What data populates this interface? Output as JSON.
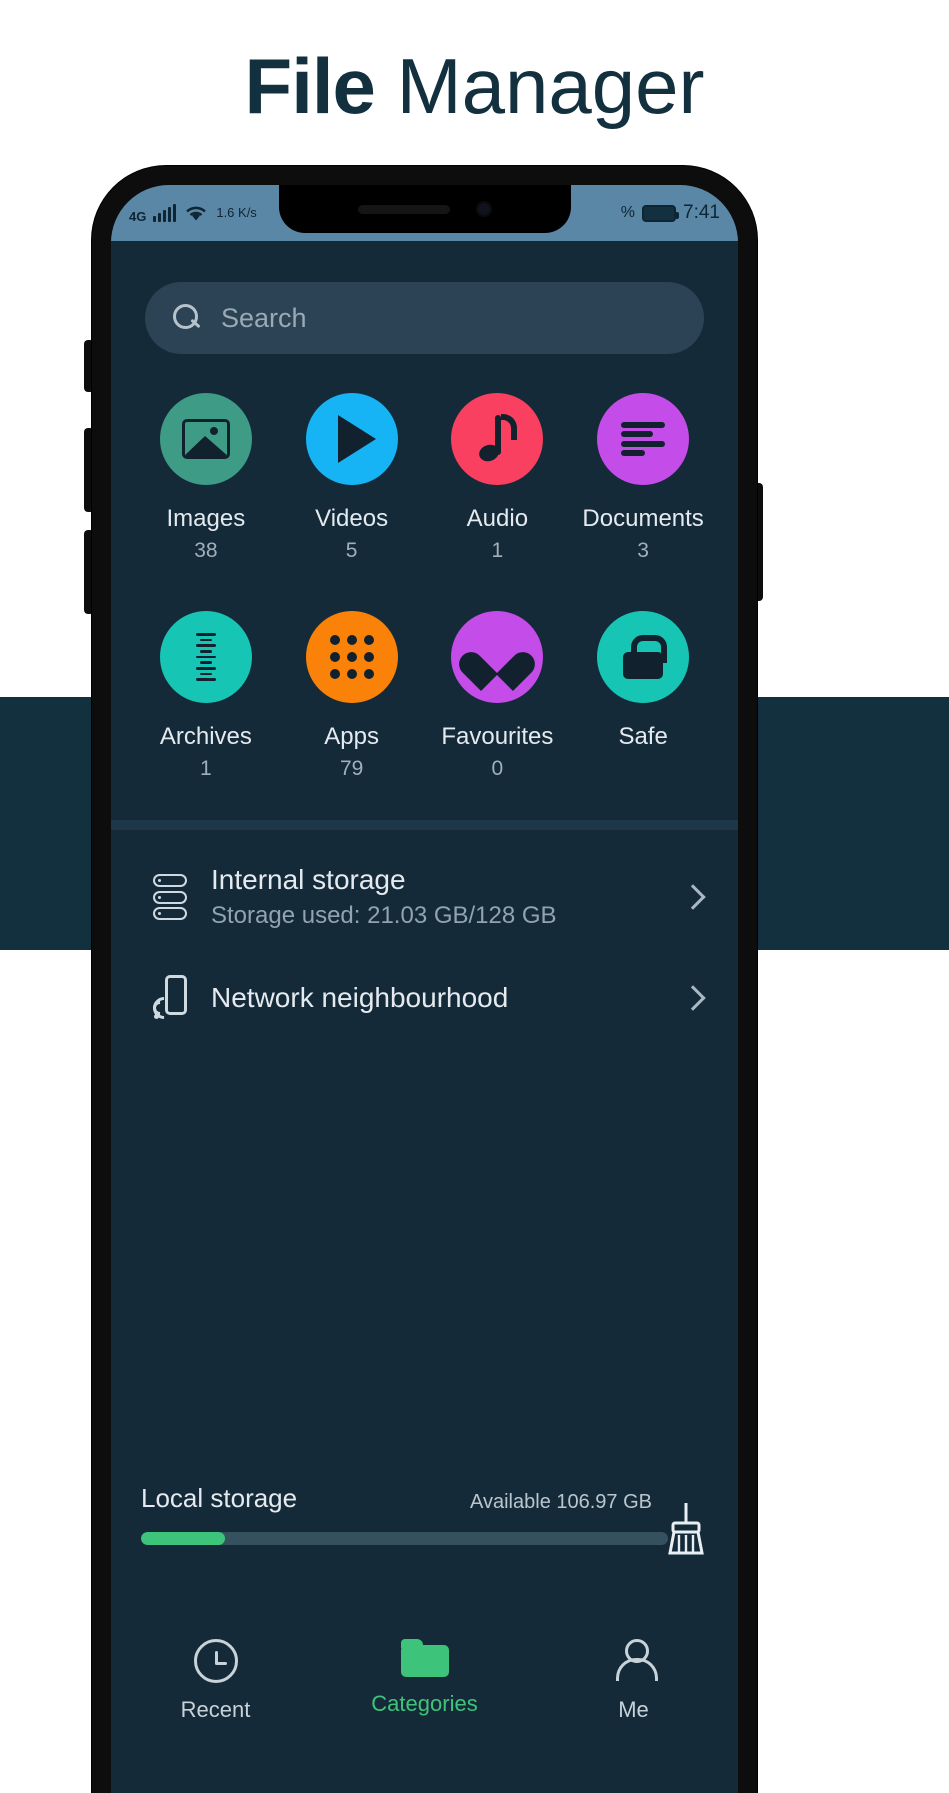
{
  "header": {
    "title_bold": "File",
    "title_light": "Manager"
  },
  "status_bar": {
    "network_type": "4G",
    "data_rate": "1.6 K/s",
    "battery_percent_symbol": "%",
    "time": "7:41"
  },
  "search": {
    "placeholder": "Search",
    "value": ""
  },
  "categories": [
    {
      "label": "Images",
      "count": "38",
      "color": "#3d9b86",
      "icon": "image-icon"
    },
    {
      "label": "Videos",
      "count": "5",
      "color": "#17b4f5",
      "icon": "play-icon"
    },
    {
      "label": "Audio",
      "count": "1",
      "color": "#f94060",
      "icon": "music-note-icon"
    },
    {
      "label": "Documents",
      "count": "3",
      "color": "#c44ce8",
      "icon": "document-lines-icon"
    },
    {
      "label": "Archives",
      "count": "1",
      "color": "#17c5b5",
      "icon": "archive-icon"
    },
    {
      "label": "Apps",
      "count": "79",
      "color": "#fa8208",
      "icon": "apps-grid-icon"
    },
    {
      "label": "Favourites",
      "count": "0",
      "color": "#c44ce8",
      "icon": "heart-icon"
    },
    {
      "label": "Safe",
      "count": "",
      "color": "#17c5b5",
      "icon": "lock-icon"
    }
  ],
  "storage_rows": [
    {
      "title": "Internal storage",
      "subtitle": "Storage used: 21.03 GB/128 GB",
      "icon": "server-stack-icon"
    },
    {
      "title": "Network neighbourhood",
      "subtitle": "",
      "icon": "network-device-icon"
    }
  ],
  "local_storage": {
    "label": "Local storage",
    "available": "Available 106.97 GB",
    "used_percent": 16,
    "bar_color": "#3ec47a",
    "clean_icon": "broom-icon"
  },
  "bottom_nav": [
    {
      "label": "Recent",
      "icon": "clock-icon",
      "active": false
    },
    {
      "label": "Categories",
      "icon": "folder-icon",
      "active": true
    },
    {
      "label": "Me",
      "icon": "person-icon",
      "active": false
    }
  ],
  "theme": {
    "page_bg": "#ffffff",
    "app_bg": "#152a38",
    "band": "#13303f",
    "accent": "#3ec47a",
    "search_bg": "#2b4355"
  }
}
